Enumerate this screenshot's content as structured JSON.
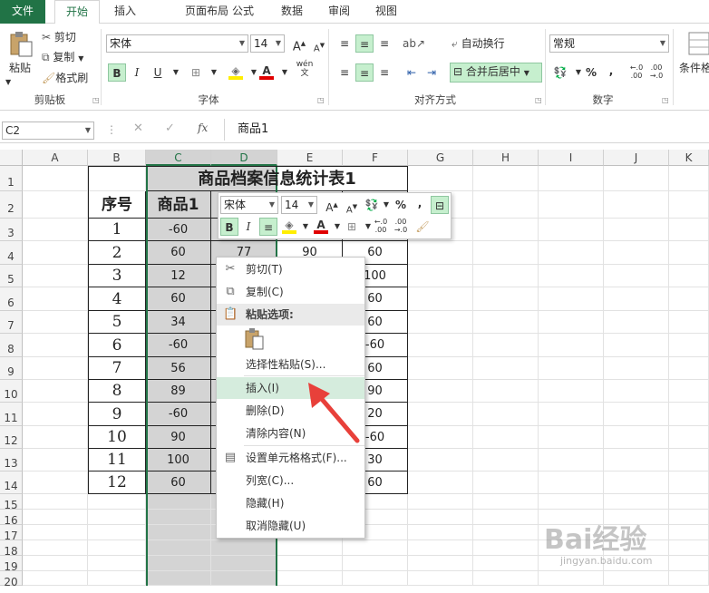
{
  "tabs": [
    "文件",
    "开始",
    "插入",
    "页面布局",
    "公式",
    "数据",
    "审阅",
    "视图"
  ],
  "clipboard": {
    "paste": "粘贴",
    "cut": "剪切",
    "copy": "复制",
    "painter": "格式刷",
    "label": "剪贴板"
  },
  "font": {
    "name": "宋体",
    "size": "14",
    "label": "字体",
    "bold": "B",
    "italic": "I",
    "underline": "U",
    "grow": "A",
    "shrink": "A",
    "wen": "wén"
  },
  "align": {
    "wrap": "自动换行",
    "merge": "合并后居中",
    "label": "对齐方式"
  },
  "number": {
    "format": "常规",
    "percent": "%",
    "comma": ",",
    "label": "数字",
    "inc": ".00",
    "dec": ".0"
  },
  "styles": {
    "cond": "条件格"
  },
  "formulabar": {
    "namebox": "C2",
    "fx": "fx",
    "value": "商品1"
  },
  "columns": [
    "A",
    "B",
    "C",
    "D",
    "E",
    "F",
    "G",
    "H",
    "I",
    "J",
    "K"
  ],
  "rows": [
    "1",
    "2",
    "3",
    "4",
    "5",
    "6",
    "7",
    "8",
    "9",
    "10",
    "11",
    "12",
    "13",
    "14",
    "15",
    "16",
    "17",
    "18",
    "19",
    "20"
  ],
  "sheet": {
    "title": "商品档案信息统计表1",
    "header_seq": "序号",
    "header_item": "商品1",
    "seq": [
      "1",
      "2",
      "3",
      "4",
      "5",
      "6",
      "7",
      "8",
      "9",
      "10",
      "11",
      "12"
    ],
    "c_vals": [
      "-60",
      "60",
      "12",
      "60",
      "34",
      "-60",
      "56",
      "89",
      "-60",
      "90",
      "100",
      "60"
    ],
    "d_visible": {
      "r4": "77"
    },
    "e_visible": {
      "r4": "90"
    },
    "f_vals": [
      "60",
      "100",
      "60",
      "60",
      "-60",
      "60",
      "90",
      "20",
      "-60",
      "30",
      "60"
    ]
  },
  "minitoolbar": {
    "font": "宋体",
    "size": "14",
    "percent": "%",
    "comma": ","
  },
  "context_menu": {
    "items": [
      {
        "label": "剪切(T)",
        "icon": "scissors-icon"
      },
      {
        "label": "复制(C)",
        "icon": "copy-icon"
      },
      {
        "label": "粘贴选项:",
        "icon": "paste-icon"
      },
      {
        "label": "",
        "icon": "paste-option-icon"
      },
      {
        "label": "选择性粘贴(S)...",
        "icon": ""
      },
      {
        "label": "插入(I)",
        "icon": ""
      },
      {
        "label": "删除(D)",
        "icon": ""
      },
      {
        "label": "清除内容(N)",
        "icon": ""
      },
      {
        "label": "设置单元格格式(F)...",
        "icon": "format-cells-icon"
      },
      {
        "label": "列宽(C)...",
        "icon": ""
      },
      {
        "label": "隐藏(H)",
        "icon": ""
      },
      {
        "label": "取消隐藏(U)",
        "icon": ""
      }
    ]
  },
  "watermark": {
    "brand": "Bai经验",
    "url": "jingyan.baidu.com"
  },
  "colors": {
    "excel_green": "#217346",
    "selection": "#d4d4d4",
    "highlight": "#c6efce",
    "arrow": "#e8403a"
  }
}
